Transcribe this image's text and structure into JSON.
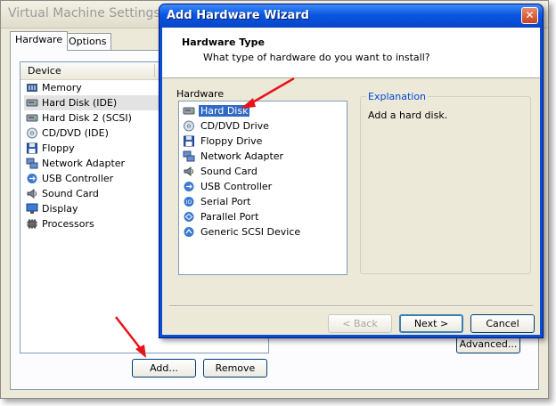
{
  "vm": {
    "title": "Virtual Machine Settings",
    "tabs": [
      {
        "label": "Hardware"
      },
      {
        "label": "Options"
      }
    ],
    "device_header": "Device",
    "devices": [
      {
        "label": "Memory",
        "icon": "memory-icon"
      },
      {
        "label": "Hard Disk (IDE)",
        "icon": "hard-disk-icon"
      },
      {
        "label": "Hard Disk 2 (SCSI)",
        "icon": "hard-disk-icon"
      },
      {
        "label": "CD/DVD (IDE)",
        "icon": "cd-dvd-icon"
      },
      {
        "label": "Floppy",
        "icon": "floppy-icon"
      },
      {
        "label": "Network Adapter",
        "icon": "network-adapter-icon"
      },
      {
        "label": "USB Controller",
        "icon": "usb-icon"
      },
      {
        "label": "Sound Card",
        "icon": "sound-card-icon"
      },
      {
        "label": "Display",
        "icon": "display-icon"
      },
      {
        "label": "Processors",
        "icon": "processor-icon"
      }
    ],
    "selected_device": "Hard Disk (IDE)",
    "add_label": "Add...",
    "remove_label": "Remove",
    "advanced_label": "Advanced..."
  },
  "wizard": {
    "title": "Add Hardware Wizard",
    "close_glyph": "✕",
    "header_title": "Hardware Type",
    "header_subtitle": "What type of hardware do you want to install?",
    "hardware_label": "Hardware",
    "hardware_items": [
      {
        "label": "Hard Disk",
        "icon": "hard-disk-icon"
      },
      {
        "label": "CD/DVD Drive",
        "icon": "cd-dvd-icon"
      },
      {
        "label": "Floppy Drive",
        "icon": "floppy-icon"
      },
      {
        "label": "Network Adapter",
        "icon": "network-adapter-icon"
      },
      {
        "label": "Sound Card",
        "icon": "sound-card-icon"
      },
      {
        "label": "USB Controller",
        "icon": "usb-icon"
      },
      {
        "label": "Serial Port",
        "icon": "serial-port-icon"
      },
      {
        "label": "Parallel Port",
        "icon": "parallel-port-icon"
      },
      {
        "label": "Generic SCSI Device",
        "icon": "scsi-icon"
      }
    ],
    "selected_item": "Hard Disk",
    "explanation_label": "Explanation",
    "explanation_text": "Add a hard disk.",
    "back_label": "< Back",
    "next_label": "Next >",
    "cancel_label": "Cancel"
  },
  "colors": {
    "annotation_arrow": "#e8141c",
    "selection": "#316ac5",
    "titlebar_blue": "#0a56e2"
  }
}
